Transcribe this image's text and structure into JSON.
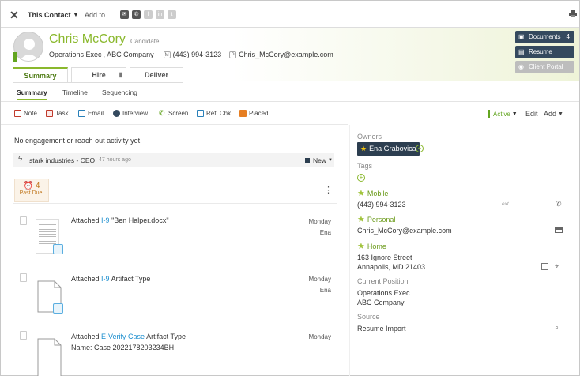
{
  "topbar": {
    "close_icon": "✕",
    "context_label": "This Contact",
    "add_to_label": "Add to..."
  },
  "header": {
    "name": "Chris McCory",
    "badge": "Candidate",
    "title": "Operations Exec",
    "company": "ABC Company",
    "phone_chip": "M",
    "phone": "(443) 994-3123",
    "email_chip": "P",
    "email": "Chris_McCory@example.com"
  },
  "right_buttons": {
    "documents_label": "Documents",
    "documents_count": "4",
    "resume_label": "Resume",
    "client_portal_label": "Client Portal"
  },
  "tabs": {
    "summary": "Summary",
    "hire": "Hire",
    "deliver": "Deliver"
  },
  "subtabs": {
    "summary": "Summary",
    "timeline": "Timeline",
    "sequencing": "Sequencing"
  },
  "actions": {
    "note": "Note",
    "task": "Task",
    "email": "Email",
    "interview": "Interview",
    "screen": "Screen",
    "ref_chk": "Ref. Chk.",
    "placed": "Placed",
    "status": "Active",
    "edit": "Edit",
    "add": "Add"
  },
  "feed": {
    "no_engagement": "No engagement or reach out activity yet",
    "stark_title": "stark industries - CEO",
    "stark_time": "47 hours ago",
    "stark_status": "New",
    "past_due_count": "4",
    "past_due_label": "Past Due!",
    "items": [
      {
        "prefix": "Attached",
        "link": "I-9",
        "suffix": "\"Ben Halper.docx\"",
        "day": "Monday",
        "who": "Ena"
      },
      {
        "prefix": "Attached",
        "link": "I-9",
        "suffix": "Artifact Type",
        "day": "Monday",
        "who": "Ena"
      },
      {
        "prefix": "Attached",
        "link": "E-Verify Case",
        "suffix": "Artifact Type",
        "sub": "Name: Case 2022178203234BH",
        "day": "Monday"
      }
    ]
  },
  "details": {
    "owners_label": "Owners",
    "owner_name": "Ena Grabovica",
    "tags_label": "Tags",
    "mobile_label": "Mobile",
    "mobile_value": "(443) 994-3123",
    "ext_label": "ext",
    "personal_label": "Personal",
    "personal_value": "Chris_McCory@example.com",
    "home_label": "Home",
    "home_line1": "163 Ignore Street",
    "home_line2": "Annapolis, MD 21403",
    "position_label": "Current Position",
    "position_title": "Operations Exec",
    "position_company": "ABC Company",
    "source_label": "Source",
    "source_value": "Resume Import"
  },
  "colors": {
    "accent_green": "#8ab82d",
    "dark_navy": "#2c3e50",
    "link_blue": "#1d8fcf"
  }
}
